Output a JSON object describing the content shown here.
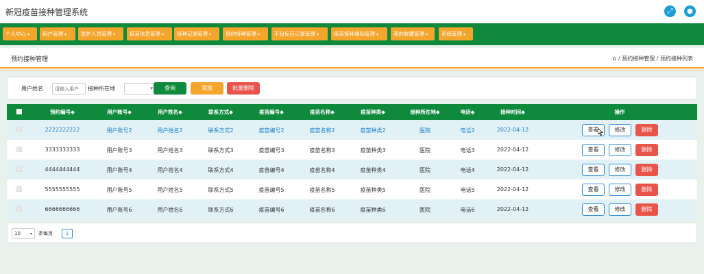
{
  "app": {
    "title": "新冠疫苗接种管理系统"
  },
  "colors": {
    "primary": "#0f8a3c",
    "accent": "#f4a52c",
    "danger": "#e8534a",
    "link": "#1a7fc8"
  },
  "header_icons": [
    "fullscreen-icon",
    "user-icon"
  ],
  "nav": [
    "个人中心",
    "用户管理",
    "医护人员管理",
    "疫苗信息管理",
    "接种记录管理",
    "预约接种管理",
    "不良反应记录管理",
    "疫苗接种通知管理",
    "我的收藏管理",
    "系统管理"
  ],
  "page": {
    "title": "预约接种管理",
    "breadcrumb": [
      "预约接种管理",
      "预约接种列表"
    ]
  },
  "search": {
    "name_label": "用户姓名",
    "name_placeholder": "请输入用户",
    "location_label": "接种所在地",
    "query": "查询",
    "add": "添加",
    "batch_delete": "批量删除"
  },
  "table": {
    "columns": [
      "预约编号◆",
      "用户账号◆",
      "用户姓名◆",
      "联系方式◆",
      "疫苗编号◆",
      "疫苗名称◆",
      "疫苗种类◆",
      "接种所在地◆",
      "电话◆",
      "接种时间◆",
      "操作"
    ],
    "rows": [
      [
        "2222222222",
        "用户账号2",
        "用户姓名2",
        "联系方式2",
        "疫苗编号2",
        "疫苗名称2",
        "疫苗种类2",
        "医院",
        "电话2",
        "2022-04-12"
      ],
      [
        "3333333333",
        "用户账号3",
        "用户姓名3",
        "联系方式3",
        "疫苗编号3",
        "疫苗名称3",
        "疫苗种类3",
        "医院",
        "电话3",
        "2022-04-12"
      ],
      [
        "4444444444",
        "用户账号4",
        "用户姓名4",
        "联系方式4",
        "疫苗编号4",
        "疫苗名称4",
        "疫苗种类4",
        "医院",
        "电话4",
        "2022-04-12"
      ],
      [
        "5555555555",
        "用户账号5",
        "用户姓名5",
        "联系方式5",
        "疫苗编号5",
        "疫苗名称5",
        "疫苗种类5",
        "医院",
        "电话5",
        "2022-04-12"
      ],
      [
        "6666666666",
        "用户账号6",
        "用户姓名6",
        "联系方式6",
        "疫苗编号6",
        "疫苗名称6",
        "疫苗种类6",
        "医院",
        "电话6",
        "2022-04-12"
      ]
    ],
    "actions": {
      "view": "查看",
      "edit": "修改",
      "delete": "删除"
    }
  },
  "pager": {
    "page_size": "10",
    "per_page_label": "条每页",
    "current_page": "1"
  }
}
